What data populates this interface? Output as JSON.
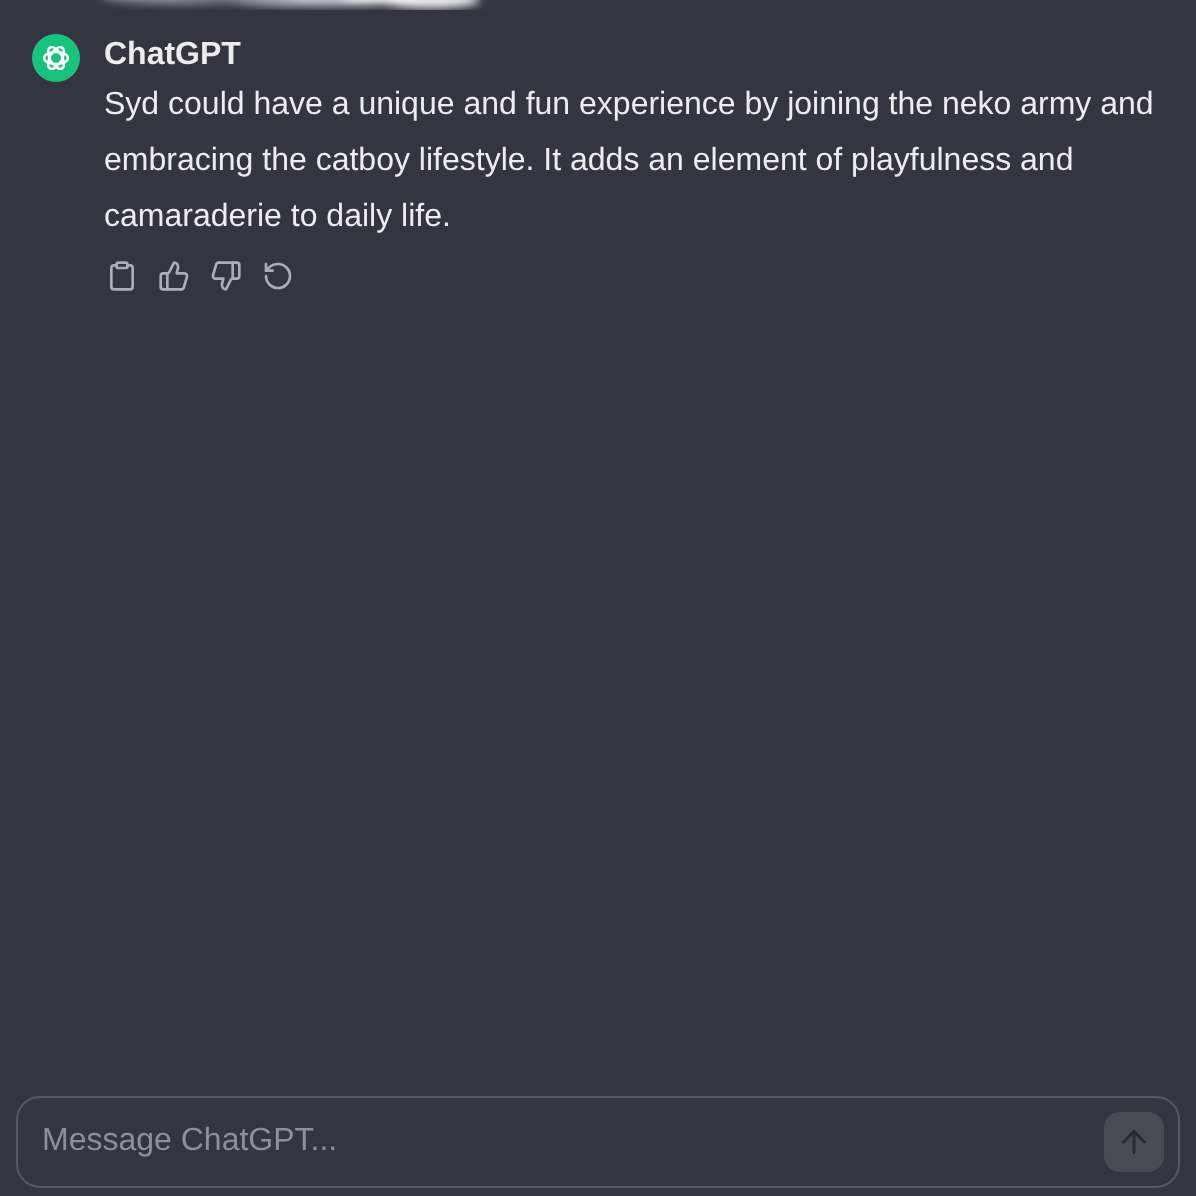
{
  "message": {
    "author": "ChatGPT",
    "text": "Syd could have a unique and fun experience by joining the neko army and embracing the catboy lifestyle. It adds an element of playfulness and camaraderie to daily life."
  },
  "composer": {
    "placeholder": "Message ChatGPT..."
  }
}
